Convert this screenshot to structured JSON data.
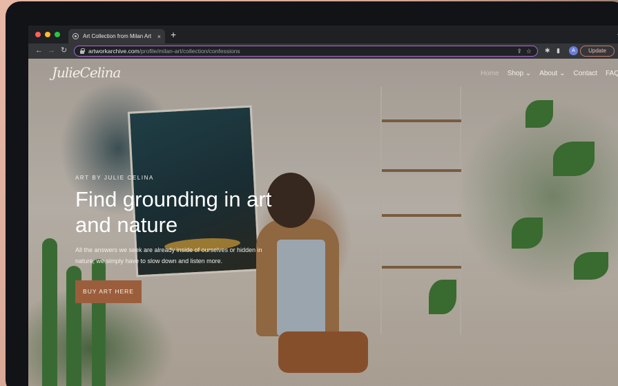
{
  "browser": {
    "tab_title": "Art Collection from Milan Art |",
    "tab_close": "×",
    "new_tab": "+",
    "url_domain": "artworkarchive.com",
    "url_path": "/profile/milan-art/collection/confessions",
    "profile_initial": "A",
    "update_label": "Update",
    "traffic_colors": [
      "#ff5f57",
      "#febc2e",
      "#28c840"
    ]
  },
  "site": {
    "logo": "JulieCelina",
    "nav": [
      "Home",
      "Shop ⌄",
      "About ⌄",
      "Contact",
      "FAQ"
    ]
  },
  "hero": {
    "eyebrow": "ART BY JULIE CELINA",
    "headline_line1": "Find grounding in art",
    "headline_line2": "and nature",
    "subtext": "All the answers we seek are already inside of ourselves or hidden in nature, we simply have to slow down and listen more.",
    "cta": "BUY ART HERE"
  }
}
